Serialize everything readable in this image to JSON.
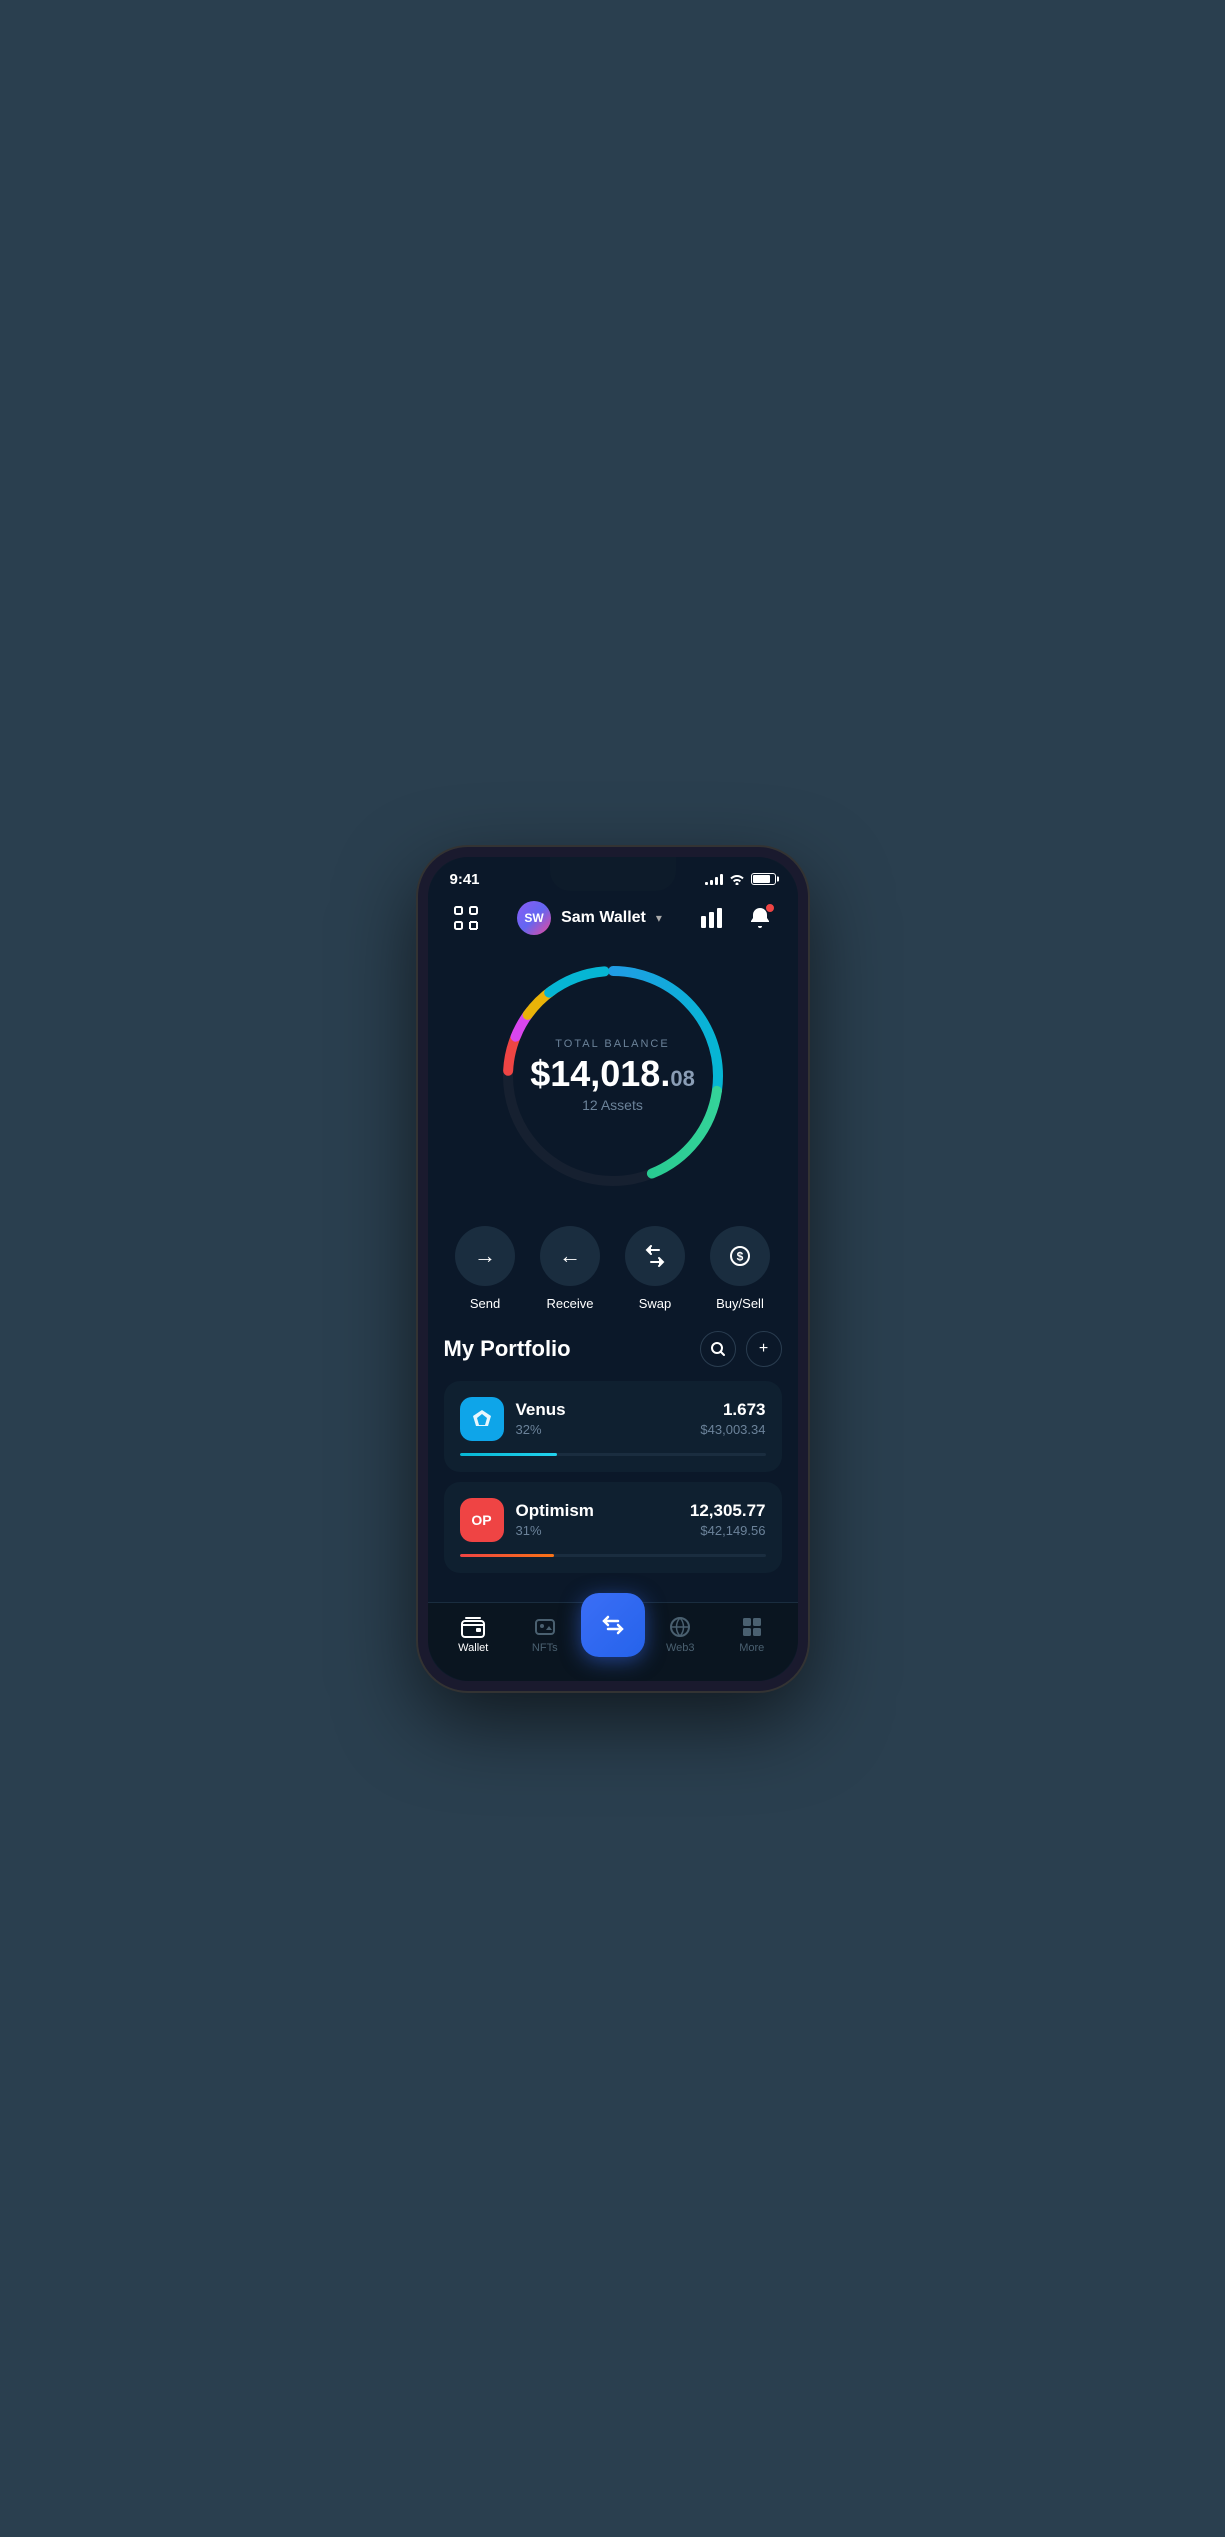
{
  "status": {
    "time": "9:41",
    "signal_bars": [
      3,
      6,
      9,
      11
    ],
    "battery_level": 85
  },
  "header": {
    "scan_label": "scan",
    "user_initials": "SW",
    "wallet_name": "Sam Wallet",
    "chevron": "▾",
    "chart_label": "chart",
    "bell_label": "notifications"
  },
  "balance": {
    "label": "TOTAL BALANCE",
    "amount_main": "$14,018.",
    "amount_cents": "08",
    "assets_label": "12 Assets"
  },
  "actions": [
    {
      "id": "send",
      "label": "Send",
      "icon": "→"
    },
    {
      "id": "receive",
      "label": "Receive",
      "icon": "←"
    },
    {
      "id": "swap",
      "label": "Swap",
      "icon": "⇅"
    },
    {
      "id": "buysell",
      "label": "Buy/Sell",
      "icon": "💲"
    }
  ],
  "portfolio": {
    "title": "My Portfolio",
    "search_label": "🔍",
    "add_label": "+"
  },
  "assets": [
    {
      "id": "venus",
      "name": "Venus",
      "pct": "32%",
      "amount": "1.673",
      "value": "$43,003.34",
      "progress": 32,
      "color_class": "venus-icon",
      "icon_text": "⟋"
    },
    {
      "id": "optimism",
      "name": "Optimism",
      "pct": "31%",
      "amount": "12,305.77",
      "value": "$42,149.56",
      "progress": 31,
      "color_class": "op-icon",
      "icon_text": "OP"
    }
  ],
  "bottom_nav": [
    {
      "id": "wallet",
      "label": "Wallet",
      "icon": "👛",
      "active": true
    },
    {
      "id": "nfts",
      "label": "NFTs",
      "icon": "🖼",
      "active": false
    },
    {
      "id": "center",
      "label": "",
      "icon": "⇅",
      "is_center": true
    },
    {
      "id": "web3",
      "label": "Web3",
      "icon": "🌐",
      "active": false
    },
    {
      "id": "more",
      "label": "More",
      "icon": "⊞",
      "active": false
    }
  ]
}
